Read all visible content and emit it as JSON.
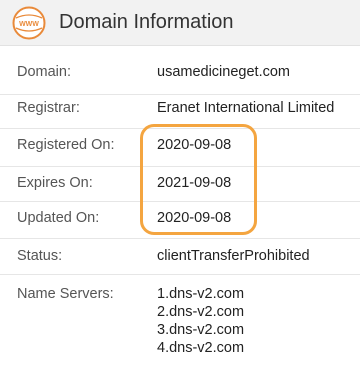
{
  "header": {
    "icon_text": "WWW",
    "title": "Domain Information"
  },
  "rows": [
    {
      "label": "Domain:",
      "value": "usamedicineget.com"
    },
    {
      "label": "Registrar:",
      "value": "Eranet International Limited"
    },
    {
      "label": "Registered On:",
      "value": "2020-09-08"
    },
    {
      "label": "Expires On:",
      "value": "2021-09-08"
    },
    {
      "label": "Updated On:",
      "value": "2020-09-08"
    },
    {
      "label": "Status:",
      "value": "clientTransferProhibited"
    }
  ],
  "name_servers": {
    "label": "Name Servers:",
    "values": [
      "1.dns-v2.com",
      "2.dns-v2.com",
      "3.dns-v2.com",
      "4.dns-v2.com"
    ]
  },
  "colors": {
    "accent_orange": "#f4a540",
    "header_bg": "#f2f2f2"
  }
}
